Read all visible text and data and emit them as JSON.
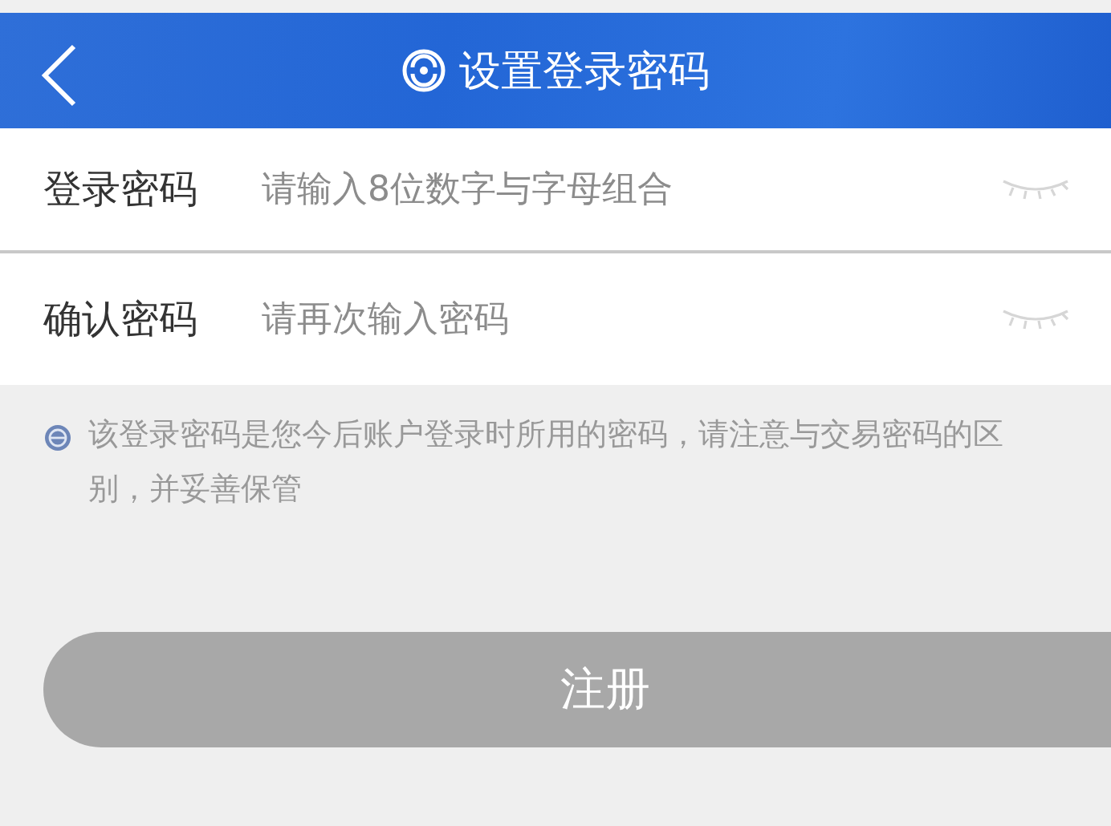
{
  "header": {
    "title": "设置登录密码"
  },
  "fields": [
    {
      "label": "登录密码",
      "placeholder": "请输入8位数字与字母组合"
    },
    {
      "label": "确认密码",
      "placeholder": "请再次输入密码"
    }
  ],
  "note": "该登录密码是您今后账户登录时所用的密码，请注意与交易密码的区别，并妥善保管",
  "submit": {
    "label": "注册",
    "disabled": true
  }
}
